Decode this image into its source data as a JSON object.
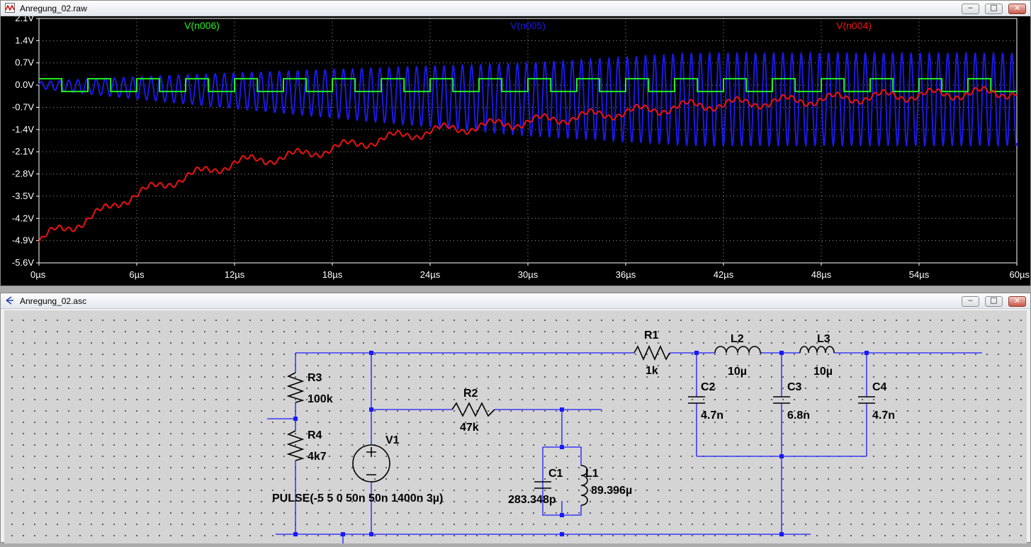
{
  "plot_window": {
    "title": "Anregung_02.raw",
    "buttons": {
      "minimize": "‒",
      "maximize": "□",
      "close": "✕"
    }
  },
  "schematic_window": {
    "title": "Anregung_02.asc",
    "buttons": {
      "minimize": "‒",
      "maximize": "□",
      "close": "✕"
    }
  },
  "colors": {
    "plot_bg": "#000000",
    "wire": "#1a1aff",
    "schematic_bg": "#d4d4d4"
  },
  "chart_data": {
    "type": "line",
    "x_tick_labels": [
      "0µs",
      "6µs",
      "12µs",
      "18µs",
      "24µs",
      "30µs",
      "36µs",
      "42µs",
      "48µs",
      "54µs",
      "60µs"
    ],
    "y_tick_labels": [
      "2.1V",
      "1.4V",
      "0.7V",
      "0.0V",
      "-0.7V",
      "-1.4V",
      "-2.1V",
      "-2.8V",
      "-3.5V",
      "-4.2V",
      "-4.9V",
      "-5.6V"
    ],
    "xlim": [
      0,
      60
    ],
    "ylim": [
      -5.6,
      2.1
    ],
    "grid": true,
    "legend_position": "top",
    "series": [
      {
        "name": "V(n006)",
        "color": "#22ee22",
        "kind": "pulse",
        "low": -0.2,
        "high": 0.2,
        "period_us": 3,
        "width_us": 1.4
      },
      {
        "name": "V(n005)",
        "color": "#1a1ae6",
        "kind": "oscillation",
        "center_start": 0,
        "center_end": -0.45,
        "amp_start": 0.1,
        "amp_end": 1.45,
        "cycles_per_us": 1.78
      },
      {
        "name": "V(n004)",
        "color": "#ee1111",
        "kind": "envelope",
        "points": [
          [
            0,
            -4.95
          ],
          [
            1,
            -4.6
          ],
          [
            3,
            -4.25
          ],
          [
            5,
            -3.65
          ],
          [
            8,
            -3.05
          ],
          [
            12,
            -2.45
          ],
          [
            16,
            -2.2
          ],
          [
            20,
            -1.8
          ],
          [
            24,
            -1.45
          ],
          [
            28,
            -1.25
          ],
          [
            32,
            -1.05
          ],
          [
            36,
            -0.85
          ],
          [
            40,
            -0.65
          ],
          [
            44,
            -0.55
          ],
          [
            48,
            -0.45
          ],
          [
            52,
            -0.35
          ],
          [
            56,
            -0.28
          ],
          [
            60,
            -0.22
          ]
        ],
        "ripple": 0.14,
        "ripple_per_us": 0.333
      }
    ]
  },
  "schematic": {
    "components": {
      "R1": {
        "name": "R1",
        "value": "1k"
      },
      "R2": {
        "name": "R2",
        "value": "47k"
      },
      "R3": {
        "name": "R3",
        "value": "100k"
      },
      "R4": {
        "name": "R4",
        "value": "4k7"
      },
      "V1": {
        "name": "V1",
        "value": "PULSE(-5 5 0 50n 50n 1400n 3µ)"
      },
      "C1": {
        "name": "C1",
        "value": "283.348p"
      },
      "L1": {
        "name": "L1",
        "value": "89.396µ"
      },
      "C2": {
        "name": "C2",
        "value": "4.7n"
      },
      "C3": {
        "name": "C3",
        "value": "6.8n"
      },
      "C4": {
        "name": "C4",
        "value": "4.7n"
      },
      "L2": {
        "name": "L2",
        "value": "10µ"
      },
      "L3": {
        "name": "L3",
        "value": "10µ"
      }
    }
  }
}
